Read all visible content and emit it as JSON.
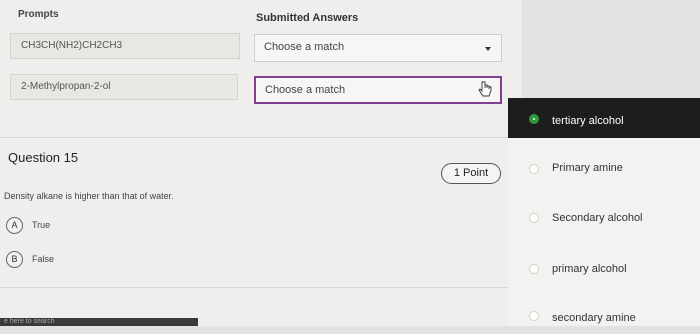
{
  "matching": {
    "prompts_header": "Prompts",
    "answers_header": "Submitted Answers",
    "rows": [
      {
        "prompt": "CH3CH(NH2)CH2CH3",
        "answer_placeholder": "Choose a match"
      },
      {
        "prompt": "2-Methylpropan-2-ol",
        "answer_placeholder": "Choose a match"
      }
    ]
  },
  "question": {
    "title": "Question 15",
    "points": "1 Point",
    "text": "Density alkane is higher than that of water.",
    "options": [
      {
        "letter": "A",
        "label": "True"
      },
      {
        "letter": "B",
        "label": "False"
      }
    ]
  },
  "dropdown": {
    "items": [
      {
        "label": "tertiary alcohol",
        "selected": true
      },
      {
        "label": "Primary amine",
        "selected": false
      },
      {
        "label": "Secondary alcohol",
        "selected": false
      },
      {
        "label": "primary alcohol",
        "selected": false
      },
      {
        "label": "secondary amine",
        "selected": false
      }
    ]
  },
  "footer": {
    "text": "e here to search"
  },
  "colors": {
    "accent": "#7d3f8e",
    "selected_bg": "#1d1d1d",
    "radio_green": "#2e9a3c"
  }
}
